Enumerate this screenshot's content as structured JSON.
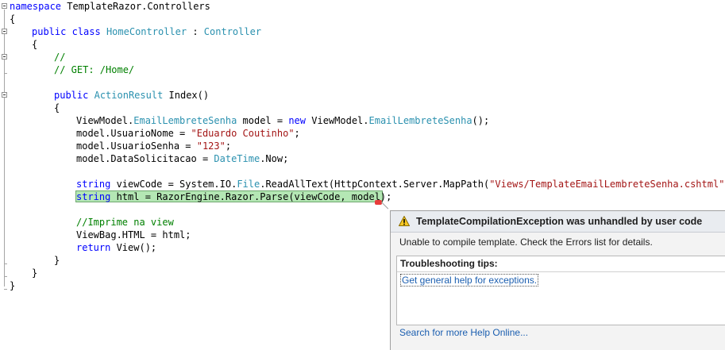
{
  "code": {
    "l1": {
      "kw": "namespace",
      "rest": " TemplateRazor.Controllers"
    },
    "l2": "{",
    "l3": {
      "kw1": "public",
      "kw2": "class",
      "type": "HomeController",
      "sep": " : ",
      "base": "Controller"
    },
    "l4": "{",
    "l5": "//",
    "l6": "// GET: /Home/",
    "l7": {
      "kw": "public",
      "type": "ActionResult",
      "rest": " Index()"
    },
    "l8": "{",
    "l9": {
      "a": "ViewModel.",
      "t1": "EmailLembreteSenha",
      "b": " model = ",
      "kw": "new",
      "c": " ViewModel.",
      "t2": "EmailLembreteSenha",
      "d": "();"
    },
    "l10": {
      "a": "model.UsuarioNome = ",
      "s": "\"Eduardo Coutinho\"",
      "b": ";"
    },
    "l11": {
      "a": "model.UsuarioSenha = ",
      "s": "\"123\"",
      "b": ";"
    },
    "l12": {
      "a": "model.DataSolicitacao = ",
      "t": "DateTime",
      "b": ".Now;"
    },
    "l13": {
      "kw": "string",
      "a": " viewCode = System.IO.",
      "t": "File",
      "b": ".ReadAllText(HttpContext.Server.MapPath(",
      "s": "\"Views/TemplateEmailLembreteSenha.cshtml\"",
      "c": "));"
    },
    "l14": {
      "kw": "string",
      "rest": " html = RazorEngine.Razor.Parse(viewCode, model);"
    },
    "l15": "//Imprime na view",
    "l16": "ViewBag.HTML = html;",
    "l17": {
      "kw": "return",
      "rest": " View();"
    },
    "l18": "}",
    "l19": "}",
    "l20": "}"
  },
  "exception": {
    "title": "TemplateCompilationException was unhandled by user code",
    "message": "Unable to compile template. Check the Errors list for details.",
    "tips_heading": "Troubleshooting tips:",
    "tips_link": "Get general help for exceptions.",
    "help_link": "Search for more Help Online...",
    "icon": "warning-icon"
  },
  "colors": {
    "keyword": "#0000ff",
    "type": "#2b91af",
    "string": "#a31515",
    "comment": "#008000",
    "highlight": "#b4e7b4",
    "link": "#1c5fb0"
  }
}
